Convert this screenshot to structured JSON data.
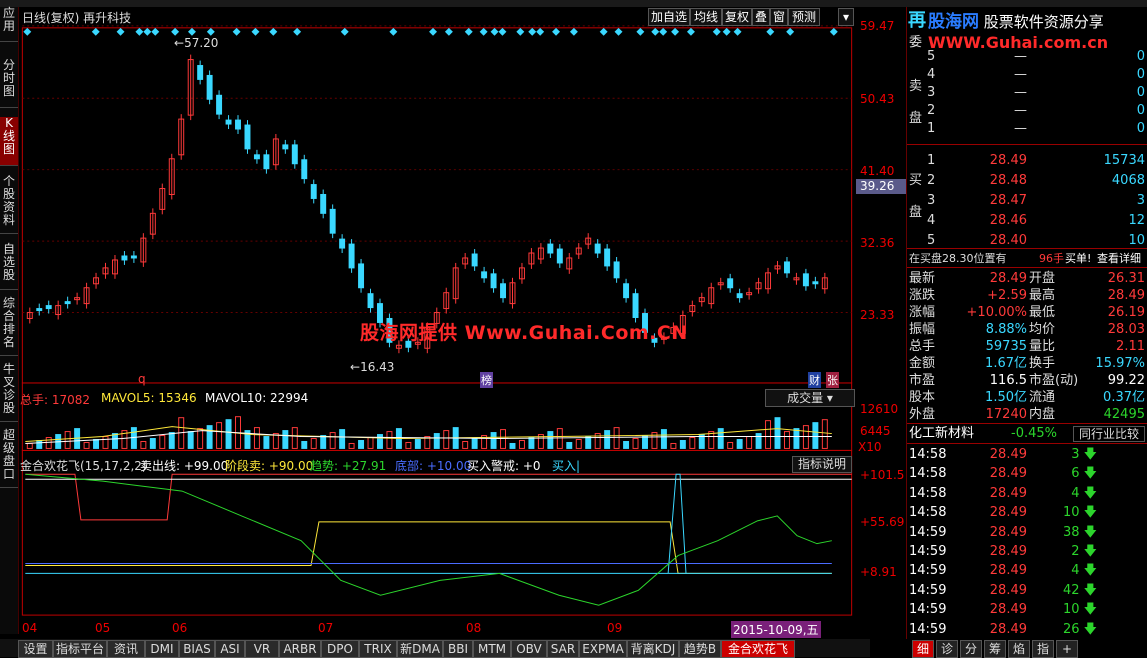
{
  "window": {
    "title": "日线(复权) 再升科技",
    "toolbar": [
      "加自选",
      "均线",
      "复权",
      "叠",
      "窗",
      "预测"
    ],
    "logo_text": "股海网 股票软件资源分享",
    "logo_url": "WWW.Guhai.com.cn",
    "stock_glyph": "再"
  },
  "sidebar": [
    {
      "label": "应用",
      "active": false
    },
    {
      "label": "分时图",
      "active": false
    },
    {
      "label": "K线图",
      "active": true
    },
    {
      "label": "个股资料",
      "active": false
    },
    {
      "label": "自选股",
      "active": false
    },
    {
      "label": "综合排名",
      "active": false
    },
    {
      "label": "牛叉诊股",
      "active": false
    },
    {
      "label": "超级盘口",
      "active": false
    }
  ],
  "price_axis": [
    "59.47",
    "50.43",
    "41.40",
    "32.36",
    "23.33"
  ],
  "current_price": "39.26",
  "annotations": {
    "high": "57.20",
    "low": "16.43",
    "mark_q": "q",
    "mark_bang": "榜",
    "mark_cai": "财",
    "mark_zhang": "张"
  },
  "watermark": "股海网提供 Www.Guhai.Com.CN",
  "volume_panel": {
    "total_label": "总手: 17082",
    "mavol5": "MAVOL5: 15346",
    "mavol10": "MAVOL10: 22994",
    "dropdown": "成交量",
    "axis": [
      "12610",
      "6445"
    ],
    "unit": "X10"
  },
  "indicator_panel": {
    "name": "金合欢花飞(15,17,2,2)",
    "sell_line": "卖出线: +99.00",
    "stage_sell": "阶段卖: +90.00",
    "trend": "趋势: +27.91",
    "bottom": "底部: +10.00",
    "buy_alert": "买入警戒: +0",
    "buy_in": "买入|",
    "help": "指标说明",
    "axis": [
      "+101.5",
      "+55.69",
      "+8.91"
    ]
  },
  "x_axis": [
    "04",
    "05",
    "06",
    "07",
    "08",
    "09"
  ],
  "date_highlight": "2015-10-09,五",
  "bottom_tabs": [
    {
      "label": "设置",
      "active": false
    },
    {
      "label": "指标平台",
      "active": false
    },
    {
      "label": "资讯",
      "active": false
    },
    {
      "label": "DMI",
      "active": false
    },
    {
      "label": "BIAS",
      "active": false
    },
    {
      "label": "ASI",
      "active": false
    },
    {
      "label": "VR",
      "active": false
    },
    {
      "label": "ARBR",
      "active": false
    },
    {
      "label": "DPO",
      "active": false
    },
    {
      "label": "TRIX",
      "active": false
    },
    {
      "label": "新DMA",
      "active": false
    },
    {
      "label": "BBI",
      "active": false
    },
    {
      "label": "MTM",
      "active": false
    },
    {
      "label": "OBV",
      "active": false
    },
    {
      "label": "SAR",
      "active": false
    },
    {
      "label": "EXPMA",
      "active": false
    },
    {
      "label": "背离KDJ",
      "active": false
    },
    {
      "label": "趋势B",
      "active": false
    },
    {
      "label": "金合欢花飞",
      "active": true
    }
  ],
  "order_book": {
    "sell_label": "委",
    "sell_side": "卖盘",
    "buy_side": "买盘",
    "sells": [
      {
        "lvl": "5",
        "price": "—",
        "vol": "0"
      },
      {
        "lvl": "4",
        "price": "—",
        "vol": "0"
      },
      {
        "lvl": "3",
        "price": "—",
        "vol": "0"
      },
      {
        "lvl": "2",
        "price": "—",
        "vol": "0"
      },
      {
        "lvl": "1",
        "price": "—",
        "vol": "0"
      }
    ],
    "buys": [
      {
        "lvl": "1",
        "price": "28.49",
        "vol": "15734"
      },
      {
        "lvl": "2",
        "price": "28.48",
        "vol": "4068"
      },
      {
        "lvl": "3",
        "price": "28.47",
        "vol": "3"
      },
      {
        "lvl": "4",
        "price": "28.46",
        "vol": "12"
      },
      {
        "lvl": "5",
        "price": "28.40",
        "vol": "10"
      }
    ],
    "status_left": "在买盘28.30位置有",
    "status_mid": "96手",
    "status_right": "买单!",
    "detail": "查看详细"
  },
  "quote": [
    {
      "l1": "最新",
      "v1": "28.49",
      "c1": "red",
      "l2": "开盘",
      "v2": "26.31",
      "c2": "red"
    },
    {
      "l1": "涨跌",
      "v1": "+2.59",
      "c1": "red",
      "l2": "最高",
      "v2": "28.49",
      "c2": "red"
    },
    {
      "l1": "涨幅",
      "v1": "+10.00%",
      "c1": "red",
      "l2": "最低",
      "v2": "26.19",
      "c2": "red"
    },
    {
      "l1": "振幅",
      "v1": "8.88%",
      "c1": "cyan",
      "l2": "均价",
      "v2": "28.03",
      "c2": "red"
    },
    {
      "l1": "总手",
      "v1": "59735",
      "c1": "cyan",
      "l2": "量比",
      "v2": "2.11",
      "c2": "red"
    },
    {
      "l1": "金额",
      "v1": "1.67亿",
      "c1": "cyan",
      "l2": "换手",
      "v2": "15.97%",
      "c2": "cyan"
    },
    {
      "l1": "市盈",
      "v1": "116.5",
      "c1": "white",
      "l2": "市盈(动)",
      "v2": "99.22",
      "c2": "white"
    },
    {
      "l1": "股本",
      "v1": "1.50亿",
      "c1": "cyan",
      "l2": "流通",
      "v2": "0.37亿",
      "c2": "cyan"
    },
    {
      "l1": "外盘",
      "v1": "17240",
      "c1": "red",
      "l2": "内盘",
      "v2": "42495",
      "c2": "grn"
    }
  ],
  "industry": {
    "name": "化工新材料",
    "change": "-0.45%",
    "compare": "同行业比较"
  },
  "ticks": [
    {
      "time": "14:58",
      "price": "28.49",
      "vol": "3"
    },
    {
      "time": "14:58",
      "price": "28.49",
      "vol": "6"
    },
    {
      "time": "14:58",
      "price": "28.49",
      "vol": "4"
    },
    {
      "time": "14:58",
      "price": "28.49",
      "vol": "10"
    },
    {
      "time": "14:59",
      "price": "28.49",
      "vol": "38"
    },
    {
      "time": "14:59",
      "price": "28.49",
      "vol": "2"
    },
    {
      "time": "14:59",
      "price": "28.49",
      "vol": "4"
    },
    {
      "time": "14:59",
      "price": "28.49",
      "vol": "42"
    },
    {
      "time": "14:59",
      "price": "28.49",
      "vol": "10"
    },
    {
      "time": "14:59",
      "price": "28.49",
      "vol": "26"
    }
  ],
  "right_tabs": [
    "细",
    "诊",
    "分",
    "筹",
    "焰",
    "指",
    "+"
  ],
  "colors": {
    "up": "#ff3a3a",
    "down": "#3ad8ff",
    "panel_border": "#8b0000"
  }
}
